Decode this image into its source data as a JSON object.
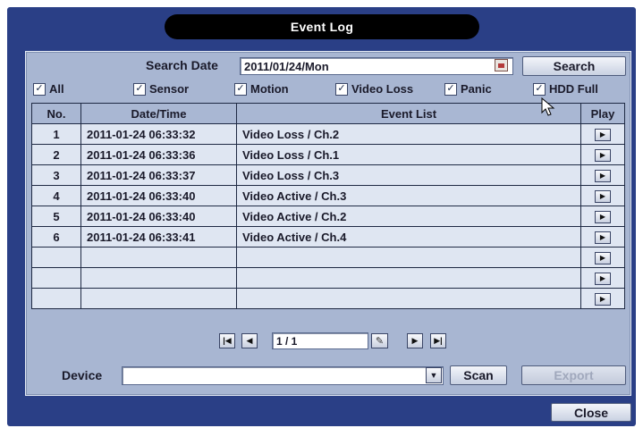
{
  "window": {
    "title": "Event Log"
  },
  "search": {
    "label": "Search Date",
    "date_value": "2011/01/24/Mon",
    "button": "Search"
  },
  "filters": [
    {
      "label": "All",
      "checked": true
    },
    {
      "label": "Sensor",
      "checked": true
    },
    {
      "label": "Motion",
      "checked": true
    },
    {
      "label": "Video Loss",
      "checked": true
    },
    {
      "label": "Panic",
      "checked": true
    },
    {
      "label": "HDD Full",
      "checked": true
    }
  ],
  "table": {
    "headers": [
      "No.",
      "Date/Time",
      "Event List",
      "Play"
    ],
    "rows": [
      {
        "no": "1",
        "datetime": "2011-01-24 06:33:32",
        "event": "Video Loss  / Ch.2"
      },
      {
        "no": "2",
        "datetime": "2011-01-24 06:33:36",
        "event": "Video Loss  / Ch.1"
      },
      {
        "no": "3",
        "datetime": "2011-01-24 06:33:37",
        "event": "Video Loss  / Ch.3"
      },
      {
        "no": "4",
        "datetime": "2011-01-24 06:33:40",
        "event": "Video Active  / Ch.3"
      },
      {
        "no": "5",
        "datetime": "2011-01-24 06:33:40",
        "event": "Video Active  / Ch.2"
      },
      {
        "no": "6",
        "datetime": "2011-01-24 06:33:41",
        "event": "Video Active  / Ch.4"
      },
      {
        "no": "",
        "datetime": "",
        "event": ""
      },
      {
        "no": "",
        "datetime": "",
        "event": ""
      },
      {
        "no": "",
        "datetime": "",
        "event": ""
      }
    ]
  },
  "pagination": {
    "page": "1 / 1"
  },
  "device": {
    "label": "Device",
    "value": "",
    "scan_button": "Scan",
    "export_button": "Export"
  },
  "close_button": "Close",
  "icons": {
    "first": "first-page-icon",
    "prev": "prev-page-icon",
    "next": "next-page-icon",
    "last": "last-page-icon",
    "calendar": "calendar-icon",
    "edit": "pencil-icon",
    "dropdown": "dropdown-arrow-icon",
    "play": "play-icon",
    "cursor": "mouse-cursor-icon"
  },
  "colors": {
    "frame": "#2a3f86",
    "panel": "#a8b6d2",
    "cell": "#dfe6f2",
    "title_bar": "#000000"
  }
}
